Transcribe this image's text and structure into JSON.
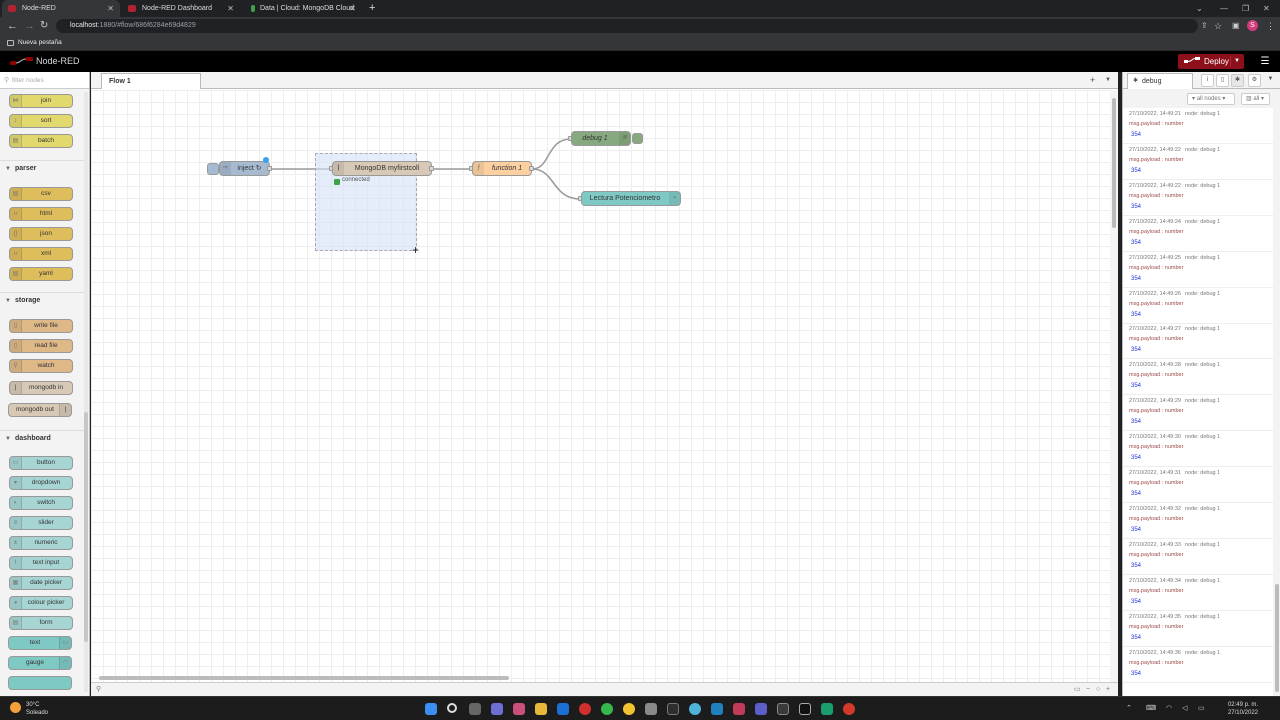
{
  "browser": {
    "tabs": [
      {
        "title": "Node-RED",
        "active": true
      },
      {
        "title": "Node-RED Dashboard",
        "active": false
      },
      {
        "title": "Data | Cloud: MongoDB Cloud",
        "active": false
      }
    ],
    "url_host": "localhost",
    "url_rest": ":1880/#flow/686f6284e69d4829",
    "bookmark": "Nueva pestaña",
    "profile_initial": "S"
  },
  "header": {
    "title": "Node-RED",
    "deploy_label": "Deploy"
  },
  "palette": {
    "filter_placeholder": "filter nodes",
    "categories": [
      {
        "name": "parser"
      },
      {
        "name": "storage"
      },
      {
        "name": "dashboard"
      }
    ],
    "sequence_nodes": [
      "join",
      "sort",
      "batch"
    ],
    "parser_nodes": [
      "csv",
      "html",
      "json",
      "xml",
      "yaml"
    ],
    "storage_nodes": [
      "write file",
      "read file",
      "watch",
      "mongodb in",
      "mongodb out"
    ],
    "dashboard_nodes": [
      "button",
      "dropdown",
      "switch",
      "slider",
      "numeric",
      "text input",
      "date picker",
      "colour picker",
      "form",
      "text",
      "gauge"
    ]
  },
  "workspace": {
    "flow_tab": "Flow 1",
    "nodes": {
      "inject": "inject ↻",
      "mongodb": "MongoDB myfirstcoll",
      "mongodb_status": "connected",
      "function": "function 1",
      "debug": "debug 1",
      "chart": "Lectura Potenciometro"
    }
  },
  "sidebar": {
    "tab": "debug",
    "filter_nodes": "all nodes",
    "filter_level": "all",
    "messages": [
      {
        "time": "27/10/2022, 14:49:21",
        "node": "node: debug 1",
        "topic": "msg.payload : number",
        "value": "354"
      },
      {
        "time": "27/10/2022, 14:49:22",
        "node": "node: debug 1",
        "topic": "msg.payload : number",
        "value": "354"
      },
      {
        "time": "27/10/2022, 14:49:22",
        "node": "node: debug 1",
        "topic": "msg.payload : number",
        "value": "354"
      },
      {
        "time": "27/10/2022, 14:49:24",
        "node": "node: debug 1",
        "topic": "msg.payload : number",
        "value": "354"
      },
      {
        "time": "27/10/2022, 14:49:25",
        "node": "node: debug 1",
        "topic": "msg.payload : number",
        "value": "354"
      },
      {
        "time": "27/10/2022, 14:49:26",
        "node": "node: debug 1",
        "topic": "msg.payload : number",
        "value": "354"
      },
      {
        "time": "27/10/2022, 14:49:27",
        "node": "node: debug 1",
        "topic": "msg.payload : number",
        "value": "354"
      },
      {
        "time": "27/10/2022, 14:49:28",
        "node": "node: debug 1",
        "topic": "msg.payload : number",
        "value": "354"
      },
      {
        "time": "27/10/2022, 14:49:29",
        "node": "node: debug 1",
        "topic": "msg.payload : number",
        "value": "354"
      },
      {
        "time": "27/10/2022, 14:49:30",
        "node": "node: debug 1",
        "topic": "msg.payload : number",
        "value": "354"
      },
      {
        "time": "27/10/2022, 14:49:31",
        "node": "node: debug 1",
        "topic": "msg.payload : number",
        "value": "354"
      },
      {
        "time": "27/10/2022, 14:49:32",
        "node": "node: debug 1",
        "topic": "msg.payload : number",
        "value": "354"
      },
      {
        "time": "27/10/2022, 14:49:33",
        "node": "node: debug 1",
        "topic": "msg.payload : number",
        "value": "354"
      },
      {
        "time": "27/10/2022, 14:49:34",
        "node": "node: debug 1",
        "topic": "msg.payload : number",
        "value": "354"
      },
      {
        "time": "27/10/2022, 14:49:35",
        "node": "node: debug 1",
        "topic": "msg.payload : number",
        "value": "354"
      },
      {
        "time": "27/10/2022, 14:49:36",
        "node": "node: debug 1",
        "topic": "msg.payload : number",
        "value": "354"
      }
    ]
  },
  "taskbar": {
    "temperature": "30°C",
    "weather": "Soleado",
    "time": "02:49 p. m.",
    "date": "27/10/2022"
  },
  "colors": {
    "deploy": "#8c101c",
    "debug_node": "#87a980",
    "chart_node": "#7fc9c5",
    "function_node": "#fdd0a2",
    "inject_node": "#a6bbcf"
  }
}
